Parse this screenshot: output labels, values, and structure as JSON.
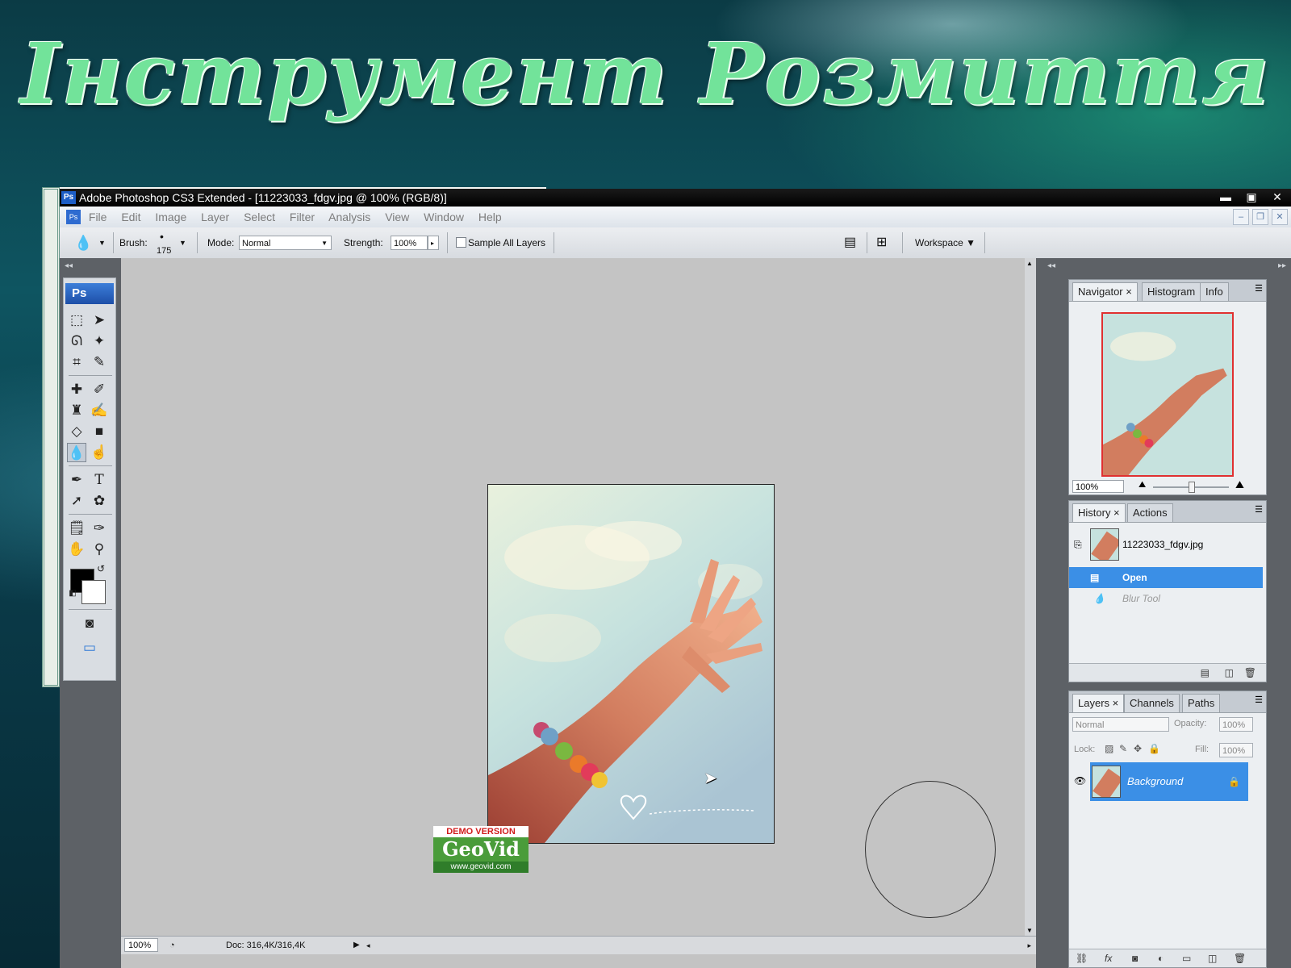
{
  "slide": {
    "title": "Інструмент Розмиття"
  },
  "window": {
    "title": "Adobe Photoshop CS3 Extended - [11223033_fdgv.jpg @ 100% (RGB/8)]",
    "app_badge": "Ps",
    "min": "▬",
    "max": "▣",
    "close": "✕"
  },
  "menu": {
    "items": [
      "File",
      "Edit",
      "Image",
      "Layer",
      "Select",
      "Filter",
      "Analysis",
      "View",
      "Window",
      "Help"
    ]
  },
  "options": {
    "brush_label": "Brush:",
    "brush_size": "175",
    "mode_label": "Mode:",
    "mode_value": "Normal",
    "strength_label": "Strength:",
    "strength_value": "100%",
    "sample_all_layers": "Sample All Layers",
    "workspace": "Workspace ▼"
  },
  "toolbox": {
    "logo": "Ps"
  },
  "status": {
    "zoom": "100%",
    "doc": "Doc: 316,4K/316,4K"
  },
  "watermark": {
    "line1": "DEMO VERSION",
    "line2": "GeoVid",
    "line3": "www.geovid.com"
  },
  "navigator": {
    "tabs": [
      "Navigator ×",
      "Histogram",
      "Info"
    ],
    "zoom": "100%"
  },
  "history": {
    "tabs": [
      "History ×",
      "Actions"
    ],
    "snapshot": "11223033_fdgv.jpg",
    "items": [
      "Open",
      "Blur Tool"
    ]
  },
  "layers": {
    "tabs": [
      "Layers ×",
      "Channels",
      "Paths"
    ],
    "blend_mode": "Normal",
    "opacity_label": "Opacity:",
    "opacity": "100%",
    "lock_label": "Lock:",
    "fill_label": "Fill:",
    "fill": "100%",
    "layer_name": "Background"
  },
  "colors": {
    "accent": "#3b8fe6",
    "title_green": "#72e39a",
    "photo_sky": "#c9e4e2"
  },
  "icons": {
    "blur": "blur-drop-icon",
    "marquee": "marquee-icon",
    "move": "move-icon",
    "lasso": "lasso-icon",
    "magic-wand": "magic-wand-icon",
    "crop": "crop-icon",
    "slice": "slice-icon",
    "heal": "healing-brush-icon",
    "brush": "brush-icon",
    "stamp": "clone-stamp-icon",
    "history-brush": "history-brush-icon",
    "eraser": "eraser-icon",
    "gradient": "gradient-icon",
    "smudge": "smudge-icon",
    "pen": "pen-icon",
    "type": "type-icon",
    "path-select": "path-selection-icon",
    "shape": "custom-shape-icon",
    "notes": "notes-icon",
    "eyedropper": "eyedropper-icon",
    "hand": "hand-icon",
    "zoom": "zoom-icon",
    "quick-mask": "quick-mask-icon",
    "screen-mode": "screen-mode-icon"
  }
}
